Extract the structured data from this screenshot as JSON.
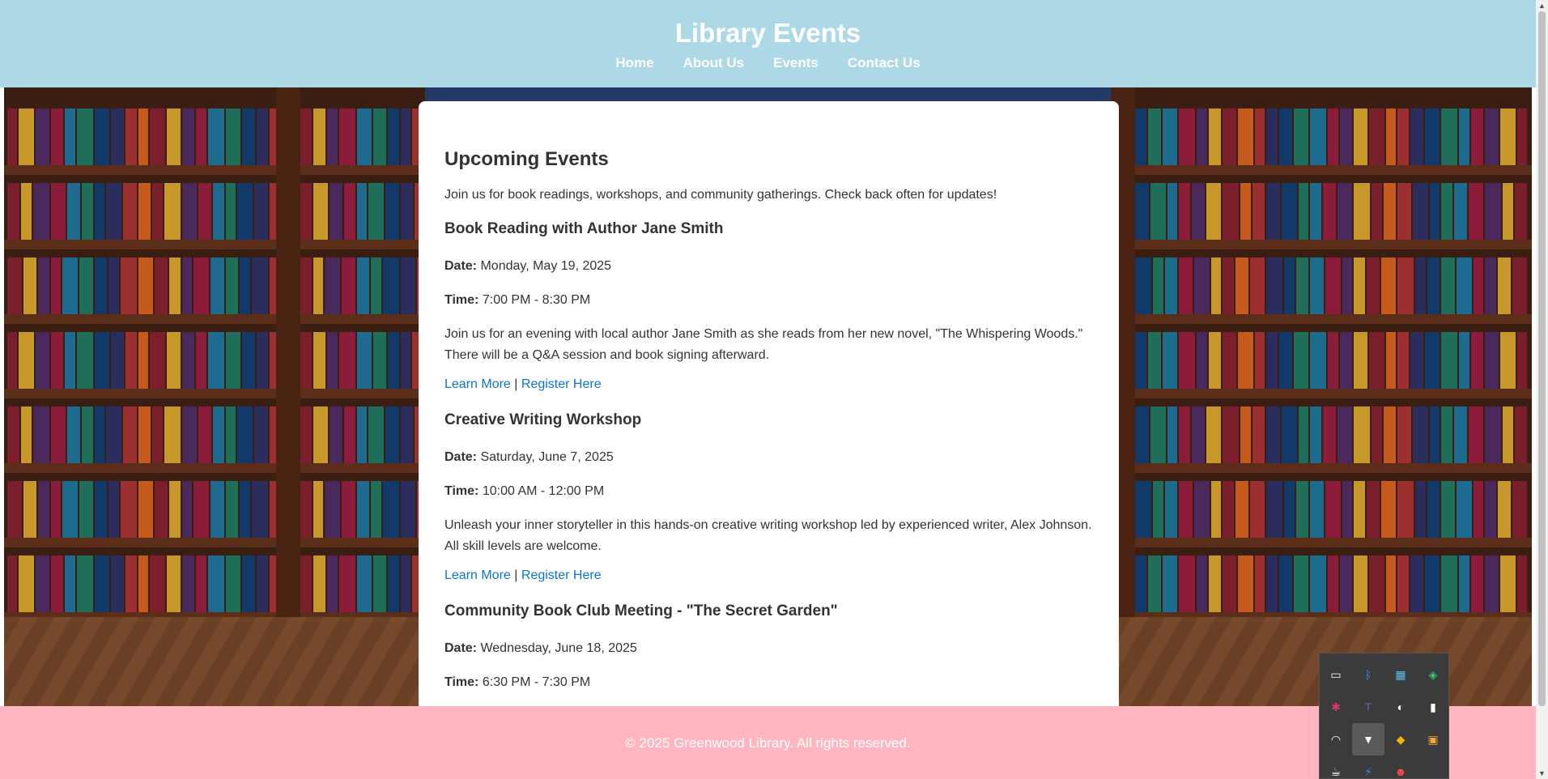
{
  "header": {
    "title": "Library Events",
    "nav": [
      "Home",
      "About Us",
      "Events",
      "Contact Us"
    ]
  },
  "main": {
    "heading": "Upcoming Events",
    "intro": "Join us for book readings, workshops, and community gatherings. Check back often for updates!",
    "date_label": "Date:",
    "time_label": "Time:",
    "learn_more": "Learn More",
    "separator": "|",
    "register": "Register Here",
    "events": [
      {
        "title": "Book Reading with Author Jane Smith",
        "date": "Monday, May 19, 2025",
        "time": "7:00 PM - 8:30 PM",
        "description": "Join us for an evening with local author Jane Smith as she reads from her new novel, \"The Whispering Woods.\" There will be a Q&A session and book signing afterward."
      },
      {
        "title": "Creative Writing Workshop",
        "date": "Saturday, June 7, 2025",
        "time": "10:00 AM - 12:00 PM",
        "description": "Unleash your inner storyteller in this hands-on creative writing workshop led by experienced writer, Alex Johnson. All skill levels are welcome."
      },
      {
        "title": "Community Book Club Meeting - \"The Secret Garden\"",
        "date": "Wednesday, June 18, 2025",
        "time": "6:30 PM - 7:30 PM"
      }
    ]
  },
  "footer": {
    "text": "© 2025 Greenwood Library. All rights reserved."
  },
  "colors": {
    "header_bg": "#add8e6",
    "footer_bg": "#ffb6c1",
    "link": "#0a74d6"
  },
  "tray_icons": [
    "display-icon",
    "bluetooth-icon",
    "network-icon",
    "shield-icon",
    "slack-icon",
    "teams-icon",
    "app-icon",
    "battery-icon",
    "wifi-icon",
    "bookmark-icon",
    "drive-icon",
    "photos-icon",
    "cup-icon",
    "bolt-icon",
    "discord-icon"
  ]
}
